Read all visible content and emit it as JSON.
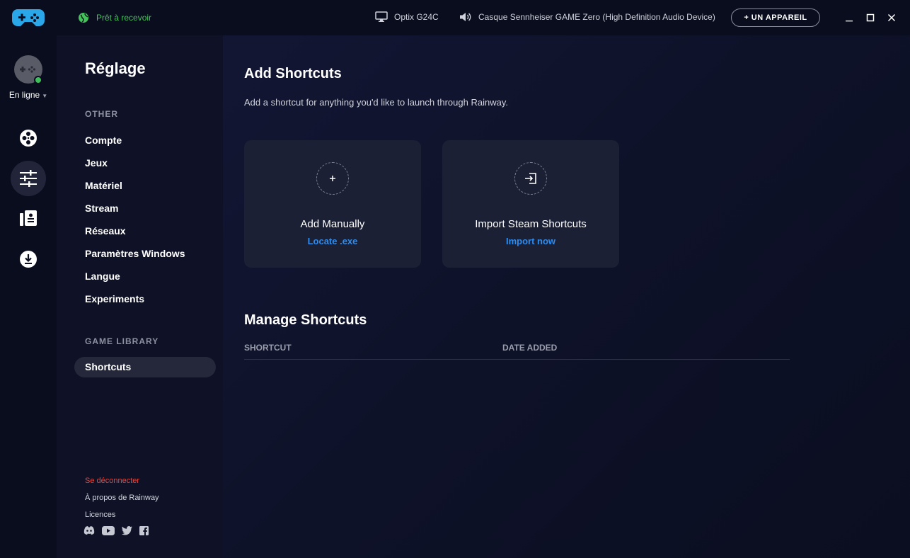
{
  "titlebar": {
    "status_text": "Prêt à recevoir",
    "monitor_name": "Optix G24C",
    "audio_device": "Casque Sennheiser GAME Zero (High Definition Audio Device)",
    "add_device_label": "+ UN APPAREIL"
  },
  "rail": {
    "presence": "En ligne",
    "items": [
      {
        "icon": "film-reel-icon"
      },
      {
        "icon": "sliders-icon",
        "active": true
      },
      {
        "icon": "library-icon"
      },
      {
        "icon": "download-icon"
      }
    ]
  },
  "nav": {
    "title": "Réglage",
    "section_other": "OTHER",
    "items": [
      "Compte",
      "Jeux",
      "Matériel",
      "Stream",
      "Réseaux",
      "Paramètres Windows",
      "Langue",
      "Experiments"
    ],
    "section_library": "GAME LIBRARY",
    "library_items": [
      "Shortcuts"
    ],
    "footer": {
      "logout": "Se déconnecter",
      "about": "À propos de Rainway",
      "licenses": "Licences"
    }
  },
  "main": {
    "add_title": "Add Shortcuts",
    "add_subtitle": "Add a shortcut for anything you'd like to launch through Rainway.",
    "cards": [
      {
        "title": "Add Manually",
        "link": "Locate .exe"
      },
      {
        "title": "Import Steam Shortcuts",
        "link": "Import now"
      }
    ],
    "manage_title": "Manage Shortcuts",
    "columns": [
      "SHORTCUT",
      "DATE ADDED"
    ]
  },
  "colors": {
    "accent_blue": "#2d8cf0",
    "online_green": "#43c35a",
    "danger_red": "#e8473f",
    "background": "#0c0f22"
  }
}
